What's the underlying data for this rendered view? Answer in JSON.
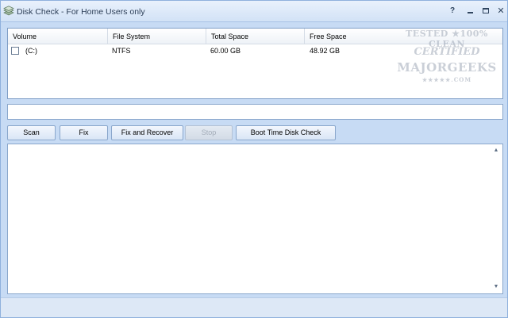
{
  "window": {
    "title": "Disk Check - For Home Users only",
    "help_label": "?",
    "close_label": "✕"
  },
  "table": {
    "columns": [
      "Volume",
      "File System",
      "Total Space",
      "Free Space"
    ],
    "rows": [
      {
        "volume": "(C:)",
        "file_system": "NTFS",
        "total_space": "60.00 GB",
        "free_space": "48.92 GB",
        "checked": false
      }
    ]
  },
  "watermark": {
    "line1": "TESTED ★100% CLEAN",
    "line2": "CERTIFIED",
    "line3": "MAJORGEEKS",
    "line4": "★★★★★.COM"
  },
  "path_field": {
    "value": ""
  },
  "buttons": {
    "scan": "Scan",
    "fix": "Fix",
    "fix_and_recover": "Fix and Recover",
    "stop": "Stop",
    "boot_time_check": "Boot Time Disk Check"
  },
  "log": {
    "text": ""
  },
  "icons": {
    "app": "disk-stack-icon",
    "scroll_up": "arrow-up-icon",
    "scroll_down": "arrow-down-icon"
  }
}
